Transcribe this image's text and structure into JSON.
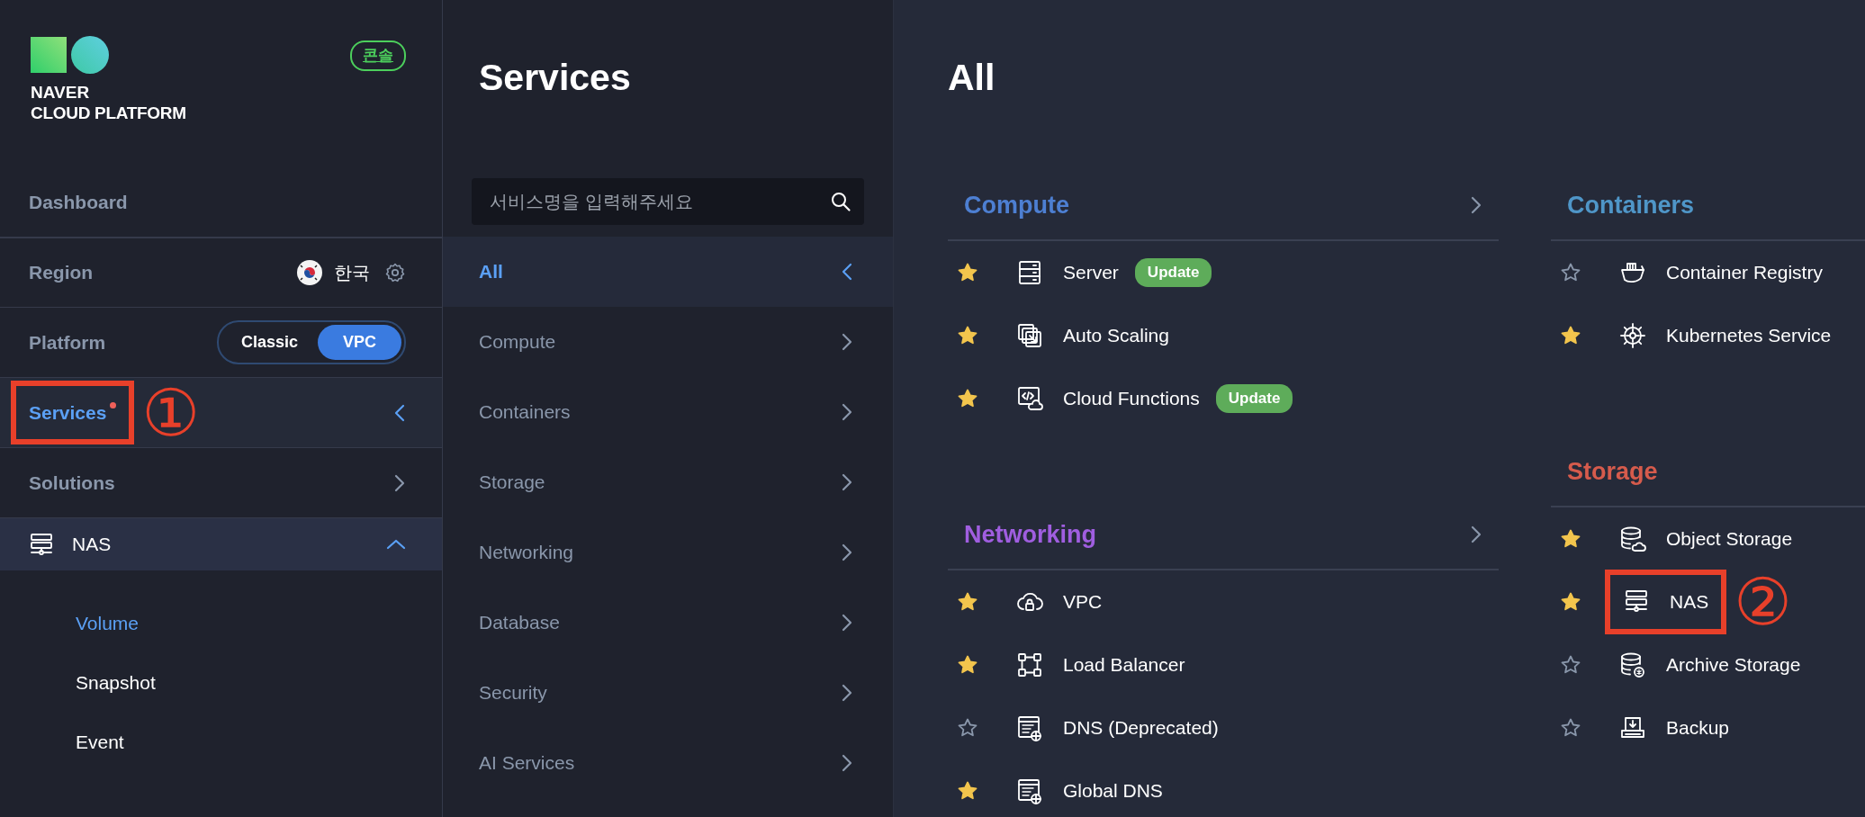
{
  "sidebar": {
    "logo": {
      "line_1": "NAVER",
      "line_2": "CLOUD PLATFORM"
    },
    "console_badge": "콘솔",
    "items": [
      {
        "kind": "link",
        "label": "Dashboard"
      },
      {
        "kind": "region",
        "label": "Region",
        "value": "한국"
      },
      {
        "kind": "toggle",
        "label": "Platform",
        "options": [
          {
            "label": "Classic",
            "selected": false
          },
          {
            "label": "VPC",
            "selected": true
          }
        ]
      },
      {
        "kind": "panel",
        "label": "Services",
        "selected": true,
        "notice": true,
        "open": true,
        "annotation": "①"
      },
      {
        "kind": "panel",
        "label": "Solutions",
        "selected": false,
        "notice": false,
        "open": false
      },
      {
        "kind": "group",
        "label": "NAS",
        "expanded": true,
        "children": [
          {
            "label": "Volume",
            "selected": true
          },
          {
            "label": "Snapshot",
            "selected": false
          },
          {
            "label": "Event",
            "selected": false
          }
        ]
      }
    ]
  },
  "services_panel": {
    "title": "Services",
    "search": {
      "placeholder": "서비스명을 입력해주세요"
    },
    "categories": [
      {
        "label": "All",
        "selected": true
      },
      {
        "label": "Compute",
        "selected": false
      },
      {
        "label": "Containers",
        "selected": false
      },
      {
        "label": "Storage",
        "selected": false
      },
      {
        "label": "Networking",
        "selected": false
      },
      {
        "label": "Database",
        "selected": false
      },
      {
        "label": "Security",
        "selected": false
      },
      {
        "label": "AI Services",
        "selected": false
      }
    ]
  },
  "catalog": {
    "title": "All",
    "columns": [
      {
        "sections": [
          {
            "name": "Compute",
            "color": "#4d7fd2",
            "more": true,
            "services": [
              {
                "kind": "server",
                "name": "Server",
                "starred": true,
                "badge": "Update"
              },
              {
                "kind": "scaling",
                "name": "Auto Scaling",
                "starred": true
              },
              {
                "kind": "functions",
                "name": "Cloud Functions",
                "starred": true,
                "badge": "Update"
              }
            ]
          },
          {
            "name": "Networking",
            "color": "#a05ee0",
            "more": true,
            "services": [
              {
                "kind": "vpc",
                "name": "VPC",
                "starred": true
              },
              {
                "kind": "balancer",
                "name": "Load Balancer",
                "starred": true
              },
              {
                "kind": "dns",
                "name": "DNS (Deprecated)",
                "starred": false
              },
              {
                "kind": "dns",
                "name": "Global DNS",
                "starred": true
              }
            ]
          }
        ]
      },
      {
        "sections": [
          {
            "name": "Containers",
            "color": "#4f96c8",
            "services": [
              {
                "kind": "registry",
                "name": "Container Registry",
                "starred": false
              },
              {
                "kind": "kubernetes",
                "name": "Kubernetes Service",
                "starred": true
              }
            ]
          },
          {
            "name": "Storage",
            "color": "#d65b4c",
            "services": [
              {
                "kind": "object",
                "name": "Object Storage",
                "starred": true
              },
              {
                "kind": "nas",
                "name": "NAS",
                "starred": true,
                "annotation": "②"
              },
              {
                "kind": "archive",
                "name": "Archive Storage",
                "starred": false
              },
              {
                "kind": "backup",
                "name": "Backup",
                "starred": false
              }
            ]
          }
        ]
      }
    ]
  }
}
